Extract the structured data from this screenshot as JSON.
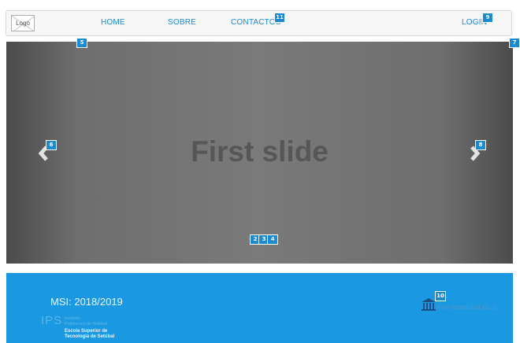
{
  "navbar": {
    "logo_label": "Logo",
    "links": {
      "home": "HOME",
      "sobre": "SOBRE",
      "contactos": "CONTACTOS",
      "login": "LOGIN"
    }
  },
  "carousel": {
    "slide_caption": "First slide",
    "active_indicator": 1,
    "indicator_count": 3
  },
  "footer": {
    "msi_label": "MSI: 2018/2019",
    "ips": {
      "mark": "IPS",
      "line1": "Instituto",
      "line2": "Politécnico de Setúbal",
      "line3": "Escola Superior de",
      "line4": "Tecnologia de Setúbal"
    },
    "site_link": "www.estsetubal.ips.pt"
  },
  "badges": {
    "b2": "2",
    "b3": "3",
    "b4": "4",
    "b5": "5",
    "b6": "6",
    "b7": "7",
    "b8": "8",
    "b9": "9",
    "b10": "10",
    "b11": "11"
  },
  "colors": {
    "accent": "#1a8bd0",
    "footer_bg": "#1a98e1",
    "badge_bg": "#1a8bd0"
  }
}
